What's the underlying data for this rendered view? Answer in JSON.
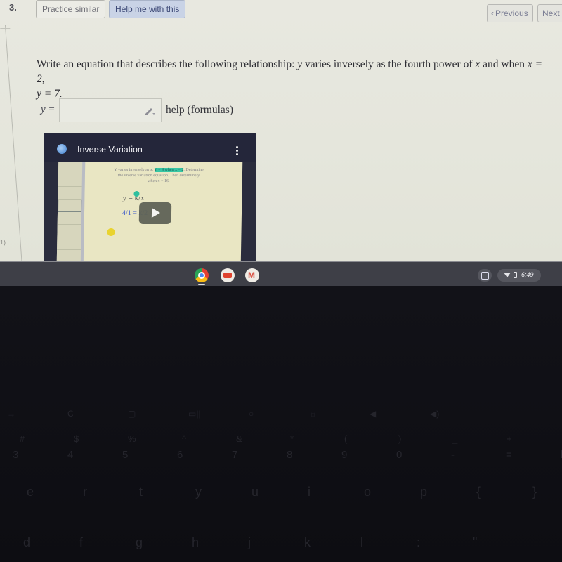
{
  "topbar": {
    "question_number": "3.",
    "practice_button": "Practice similar",
    "help_button": "Help me with this",
    "previous_button": "Previous",
    "next_button": "Next"
  },
  "question": {
    "text_before": "Write an equation that describes the following relationship: ",
    "var_y": "y",
    "text_mid": " varies inversely as the fourth power of ",
    "var_x": "x",
    "text_when": " and when ",
    "cond_x": "x = 2,",
    "cond_y": "y = 7."
  },
  "answer": {
    "label": "y =",
    "value": "",
    "placeholder": "",
    "help_link": "help (formulas)"
  },
  "video": {
    "title": "Inverse Variation",
    "slide_text_line1": "Y varies inversely as x.",
    "slide_highlight": "Y = 4 when x = 2",
    "slide_text_line1_end": ". Determine",
    "slide_text_line2": "the inverse variation equation. Then determine y",
    "slide_text_line3": "when x = 16.",
    "handwriting_1": "y = k/x",
    "handwriting_2": "4/1 = k/2"
  },
  "margin_label": "1)",
  "shelf": {
    "apps": [
      "Chrome",
      "YouTube",
      "Gmail"
    ],
    "clock": "6:49"
  },
  "keyboard": {
    "row_fn": [
      "→",
      "C",
      "▢",
      "▭||",
      "○",
      "☼",
      "◀",
      "◀)"
    ],
    "row_shift": [
      "#",
      "$",
      "%",
      "^",
      "&",
      "*",
      "(",
      ")",
      "_",
      "+"
    ],
    "row_num": [
      "3",
      "4",
      "5",
      "6",
      "7",
      "8",
      "9",
      "0",
      "-",
      "=",
      "backspace"
    ],
    "row_top": [
      "e",
      "r",
      "t",
      "y",
      "u",
      "i",
      "o",
      "p",
      "{",
      "}"
    ],
    "row_home": [
      "d",
      "f",
      "g",
      "h",
      "j",
      "k",
      "l",
      ":",
      "\""
    ]
  }
}
